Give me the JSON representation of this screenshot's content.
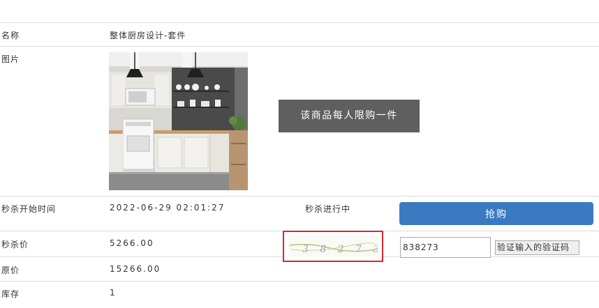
{
  "product": {
    "name_label": "名称",
    "name_value": "整体厨房设计-套件",
    "image_label": "图片",
    "start_label": "秒杀开始时间",
    "start_value": "2022-06-29 02:01:27",
    "status": "秒杀进行中",
    "seckill_price_label": "秒杀价",
    "seckill_price_value": "5266.00",
    "original_price_label": "原价",
    "original_price_value": "15266.00",
    "stock_label": "库存",
    "stock_value": "1"
  },
  "toast": {
    "message": "该商品每人限购一件"
  },
  "actions": {
    "buy_label": "抢购",
    "captcha_value": "838273",
    "captcha_text": "3 8 2 7 3",
    "verify_label": "验证输入的验证码"
  },
  "colors": {
    "buy_button": "#3a7ac1",
    "toast_bg": "#5f5f5f",
    "highlight_border": "#d9262b"
  }
}
